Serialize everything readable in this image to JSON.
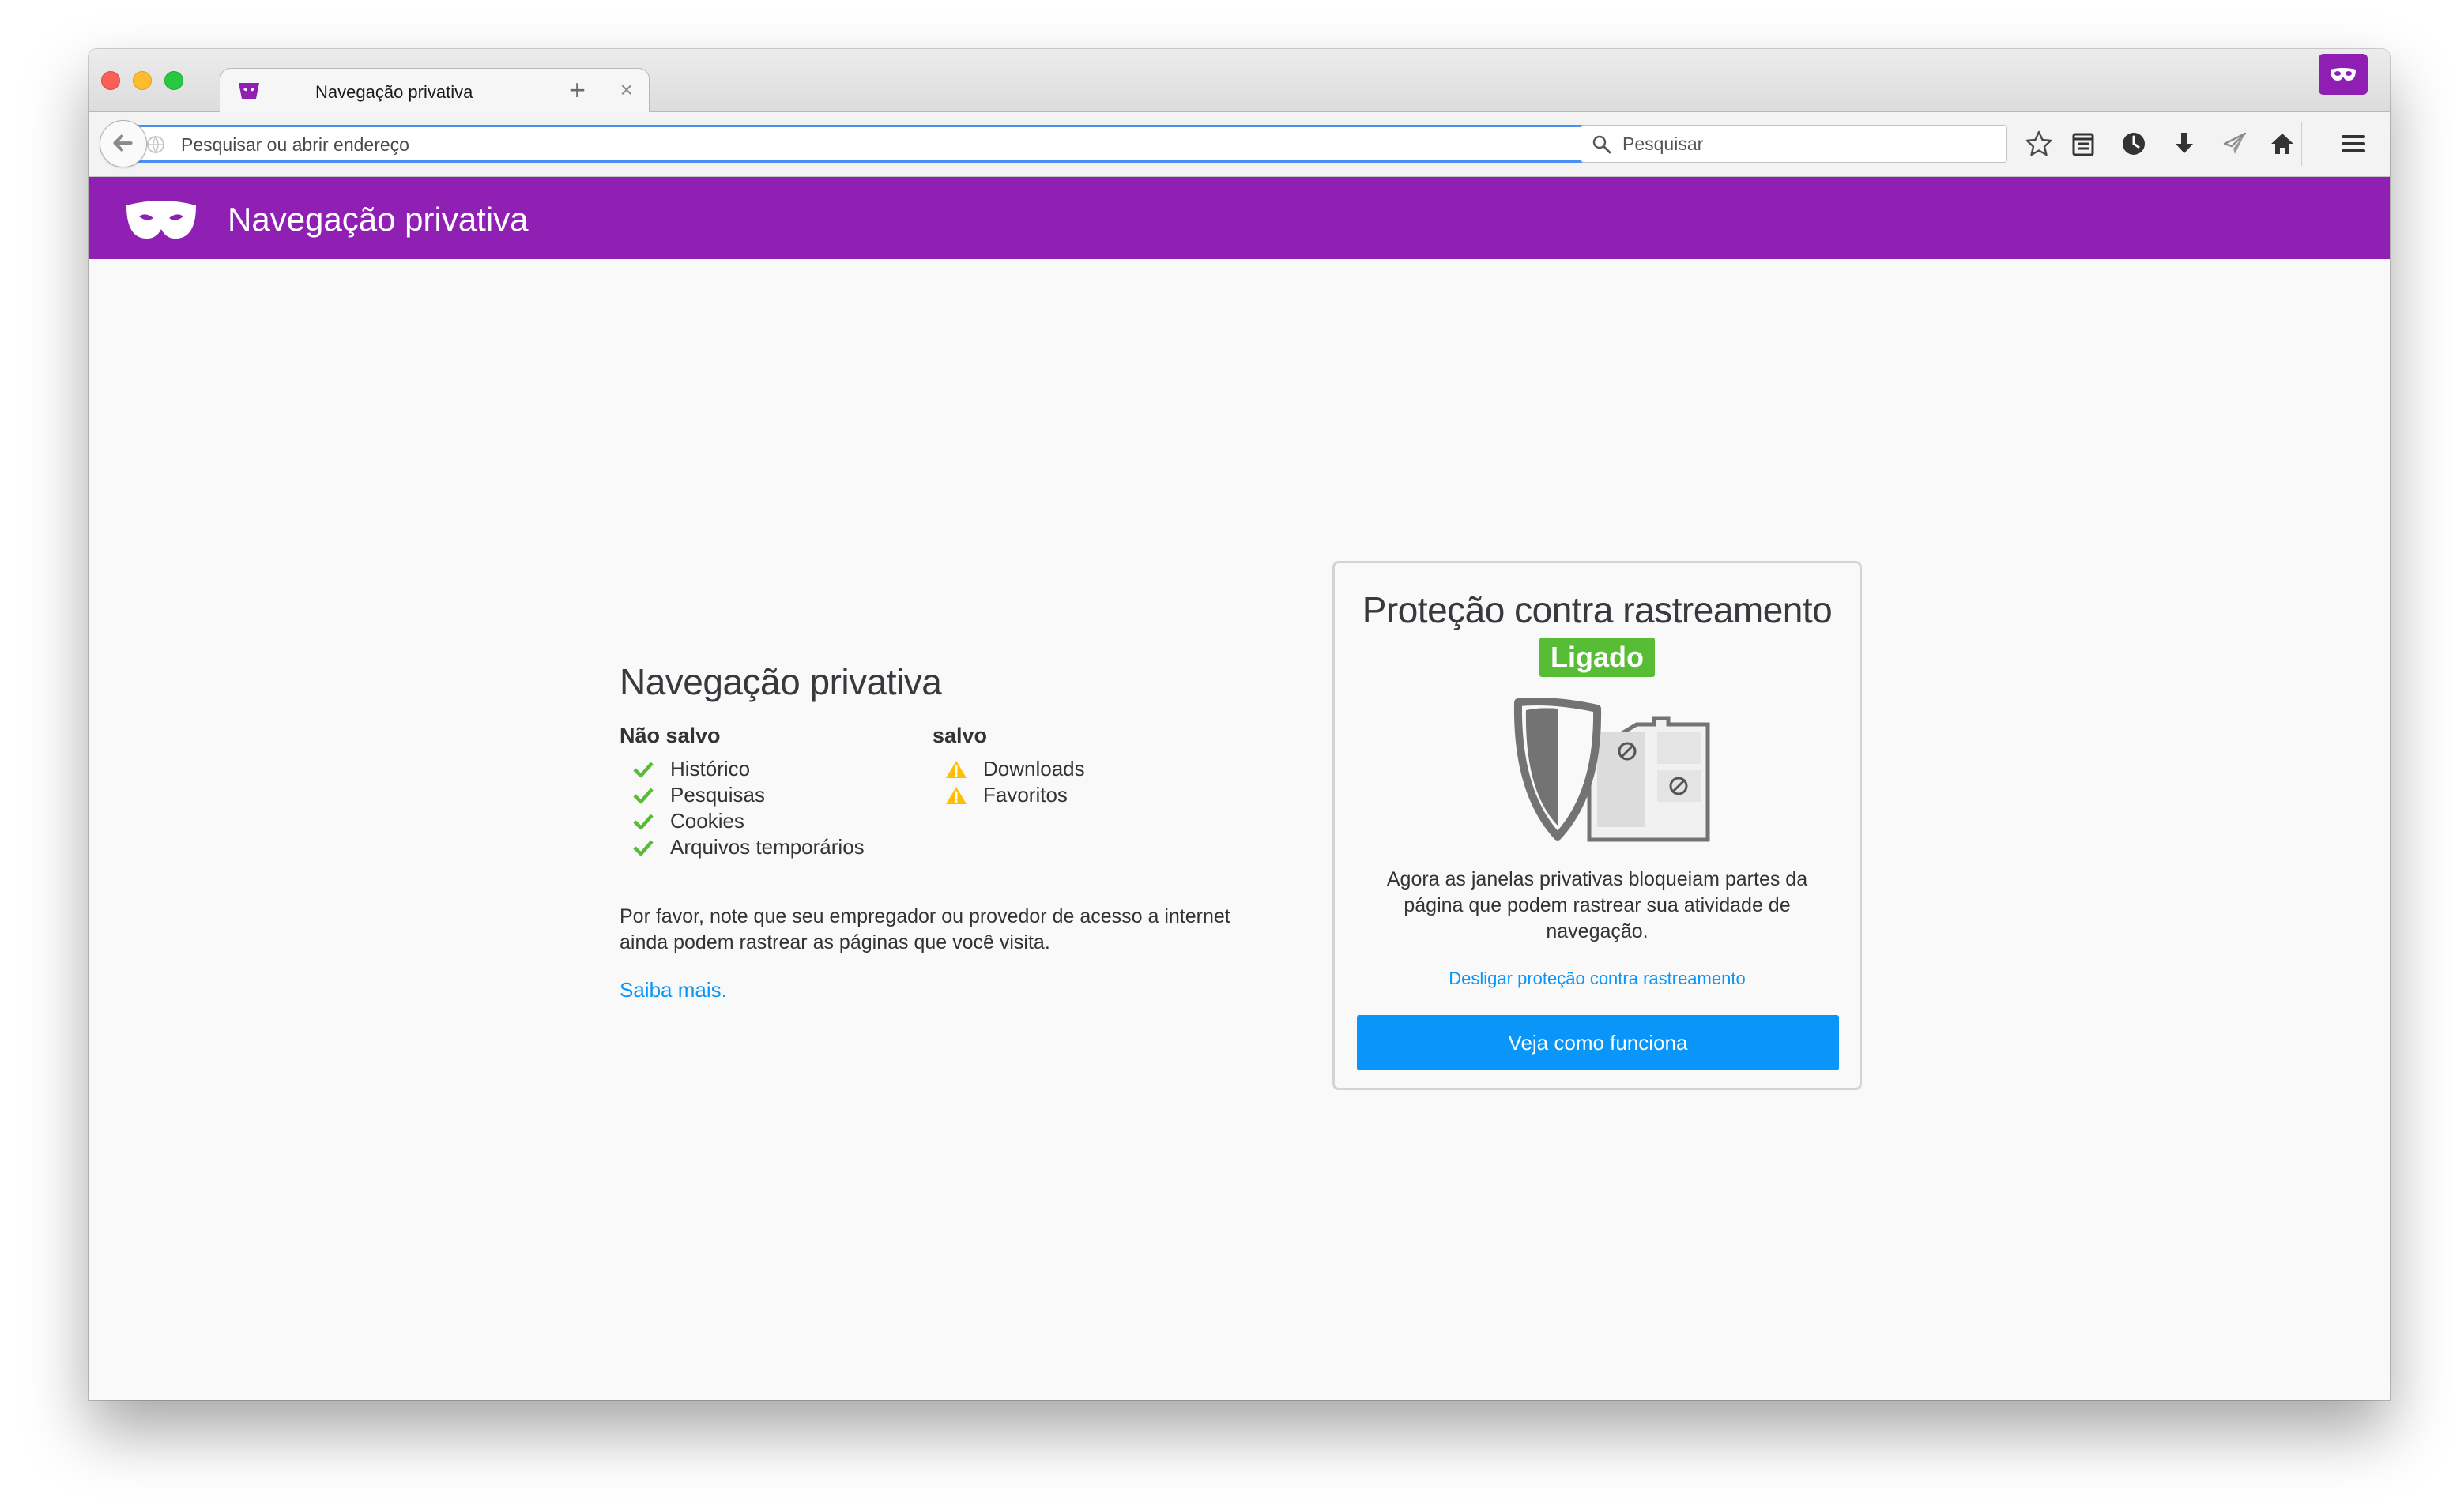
{
  "browser": {
    "tab": {
      "title": "Navegação privativa",
      "close_glyph": "×"
    },
    "new_tab_glyph": "+",
    "url_bar": {
      "placeholder": "Pesquisar ou abrir endereço",
      "value": ""
    },
    "search_bar": {
      "placeholder": "Pesquisar"
    },
    "colors": {
      "private_purple": "#8f20b3",
      "focus_blue": "#4a90f0"
    }
  },
  "header": {
    "title": "Navegação privativa"
  },
  "info": {
    "title": "Navegação privativa",
    "not_saved": {
      "title": "Não salvo",
      "items": [
        "Histórico",
        "Pesquisas",
        "Cookies",
        "Arquivos temporários"
      ],
      "icon": "check-icon"
    },
    "saved": {
      "title": "salvo",
      "items": [
        "Downloads",
        "Favoritos"
      ],
      "icon": "warning-icon"
    },
    "note": "Por favor, note que seu empregador ou provedor de acesso a internet ainda podem rastrear as páginas que você visita.",
    "learn_more": "Saiba mais."
  },
  "tracking_protection": {
    "title": "Proteção contra rastreamento",
    "status": "Ligado",
    "description": "Agora as janelas privativas bloqueiam partes da página que podem rastrear sua atividade de navegação.",
    "toggle_link": "Desligar proteção contra rastreamento",
    "button": "Veja como funciona",
    "colors": {
      "status_green": "#57bd35",
      "button_blue": "#0996f8"
    }
  }
}
